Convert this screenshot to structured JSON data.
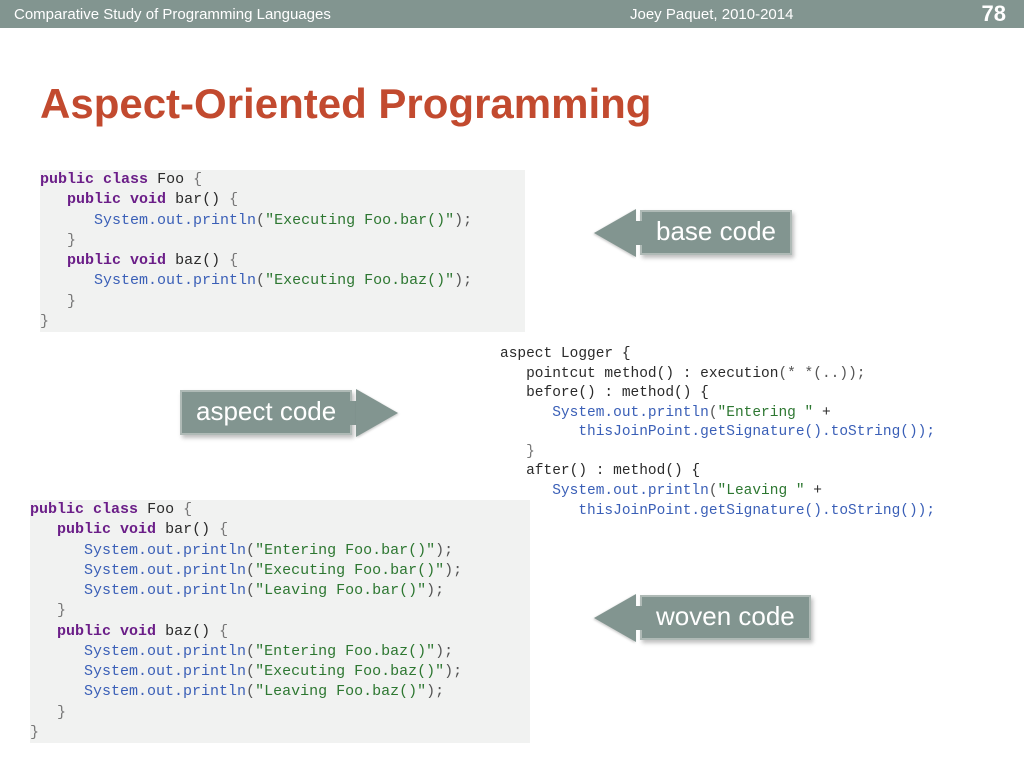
{
  "header": {
    "course": "Comparative Study of Programming Languages",
    "author": "Joey Paquet, 2010-2014",
    "pagenum": "78"
  },
  "title": "Aspect-Oriented Programming",
  "callouts": {
    "base": "base code",
    "aspect": "aspect code",
    "woven": "woven code"
  },
  "code": {
    "base": {
      "l1_kw1": "public",
      "l1_kw2": "class",
      "l1_cls": "Foo",
      "l1_brace": "{",
      "l2_kw1": "public",
      "l2_kw2": "void",
      "l2_name": "bar()",
      "l2_brace": "{",
      "l3_call": "System.out.println",
      "l3_paren": "(",
      "l3_str": "\"Executing Foo.bar()\"",
      "l3_end": ");",
      "l4_brace": "}",
      "l5_kw1": "public",
      "l5_kw2": "void",
      "l5_name": "baz()",
      "l5_brace": "{",
      "l6_call": "System.out.println",
      "l6_paren": "(",
      "l6_str": "\"Executing Foo.baz()\"",
      "l6_end": ");",
      "l7_brace": "}",
      "l8_brace": "}"
    },
    "aspect": {
      "l1": "aspect Logger {",
      "l2a": "   pointcut method() : execution",
      "l2b": "(* *(..));",
      "l3": "   before() : method() {",
      "l4_call": "      System.out.println",
      "l4_p": "(",
      "l4_str": "\"Entering \"",
      "l4_rest": " +",
      "l5": "         thisJoinPoint.getSignature().toString());",
      "l6": "   }",
      "l7": "   after() : method() {",
      "l8_call": "      System.out.println",
      "l8_p": "(",
      "l8_str": "\"Leaving \"",
      "l8_rest": " +",
      "l9": "         thisJoinPoint.getSignature().toString());"
    },
    "woven": {
      "l1_kw1": "public",
      "l1_kw2": "class",
      "l1_cls": "Foo",
      "l1_brace": "{",
      "l2_kw1": "public",
      "l2_kw2": "void",
      "l2_name": "bar()",
      "l2_brace": "{",
      "l3_call": "System.out.println",
      "l3_p": "(",
      "l3_str": "\"Entering Foo.bar()\"",
      "l3_end": ");",
      "l4_call": "System.out.println",
      "l4_p": "(",
      "l4_str": "\"Executing Foo.bar()\"",
      "l4_end": ");",
      "l5_call": "System.out.println",
      "l5_p": "(",
      "l5_str": "\"Leaving Foo.bar()\"",
      "l5_end": ");",
      "l6_brace": "}",
      "l7_kw1": "public",
      "l7_kw2": "void",
      "l7_name": "baz()",
      "l7_brace": "{",
      "l8_call": "System.out.println",
      "l8_p": "(",
      "l8_str": "\"Entering Foo.baz()\"",
      "l8_end": ");",
      "l9_call": "System.out.println",
      "l9_p": "(",
      "l9_str": "\"Executing Foo.baz()\"",
      "l9_end": ");",
      "l10_call": "System.out.println",
      "l10_p": "(",
      "l10_str": "\"Leaving Foo.baz()\"",
      "l10_end": ");",
      "l11_brace": "}",
      "l12_brace": "}"
    }
  }
}
